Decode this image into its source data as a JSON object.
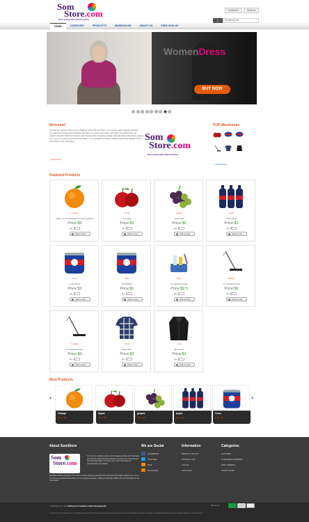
{
  "brand": {
    "line1": "Som",
    "line2a": "Store",
    "line2b": ".com",
    "tagline": "Best Quality Best Marchandise"
  },
  "toplinks": [
    "CONTACT",
    "SIGN IN"
  ],
  "cart": {
    "label": "Shopping Cart"
  },
  "nav": [
    "HOME",
    "CATEGORY",
    "PRODUCTS",
    "WAREHOUSE",
    "ABOUT US",
    "FREE SIGN UP"
  ],
  "banner": {
    "title_a": "Women",
    "title_b": "Dress",
    "button": "BUY NOW"
  },
  "welcome": {
    "title": "Welcome!",
    "text": "You can be confident when you're shopping online with SomStore. Our Secure online shopping website encrypts your personal and financial information to ensure your order information is protected.We use industry standard 128-bit encryption. Our Secure online shopping website locks all critical information passed from you to us, such as personal information, in an encrypted envelope, making it extremely difficult for this information to be intercepted.",
    "read_more": "» Read More"
  },
  "top_warehouse": {
    "title": "TOP Warehouse",
    "all_products": "» All Products"
  },
  "featured": {
    "title": "Featured Products",
    "price_label": "Price:",
    "qty_label": "Qty",
    "add_label": "Add to Cart",
    "items": [
      {
        "name": "Orange",
        "desc": "Rais_Un TV Harbours On land Heath E",
        "price": "$3",
        "qty": "1",
        "icon": "orange-icon"
      },
      {
        "name": "Apple",
        "desc": "for eating",
        "price": "$1",
        "qty": "1",
        "icon": "apple-icon"
      },
      {
        "name": "grapes",
        "desc": "fresh stuff",
        "price": "$2",
        "qty": "1",
        "icon": "grapes-icon"
      },
      {
        "name": "pepsi",
        "desc": "soda drinks",
        "price": "$1",
        "qty": "1",
        "icon": "pepsi-bottles-icon"
      },
      {
        "name": "Coca",
        "desc": "soda drinks",
        "price": "$1",
        "qty": "1",
        "icon": "pepsi-can-icon"
      },
      {
        "name": "Bad",
        "desc": "IS DRINKS",
        "price": "$1",
        "qty": "1",
        "icon": "pepsi-can-icon"
      },
      {
        "name": "Sisty",
        "desc": "for cleaning house",
        "price": "$2.5",
        "qty": "1",
        "icon": "cleaning-kit-icon"
      },
      {
        "name": "badger",
        "desc": "for cleaning house",
        "price": "$2",
        "qty": "1",
        "icon": "mop-icon"
      },
      {
        "name": "badgae",
        "desc": "for cleaning house",
        "price": "$3",
        "qty": "1",
        "icon": "mop-icon"
      },
      {
        "name": "Tshirt",
        "desc": "Best tshirt",
        "price": "$3",
        "qty": "1",
        "icon": "shirt-icon"
      },
      {
        "name": "Coat",
        "desc": "Best dress",
        "price": "$1",
        "qty": "1",
        "icon": "coat-icon"
      }
    ]
  },
  "best": {
    "title": "Best Products",
    "items": [
      {
        "name": "Orange",
        "price": "Price: $3",
        "icon": "orange-icon"
      },
      {
        "name": "Apple",
        "price": "Price: $1",
        "icon": "apple-icon"
      },
      {
        "name": "grapes",
        "price": "Price: $2",
        "icon": "grapes-icon"
      },
      {
        "name": "pepsi",
        "price": "Price: $1",
        "icon": "pepsi-bottles-icon"
      },
      {
        "name": "Coca",
        "price": "Price: $1",
        "icon": "pepsi-can-icon"
      }
    ]
  },
  "footer": {
    "about_title": "About SomStore",
    "about_text1": "You can be confident when you're shopping online with SomStore. Our Secure online shopping website encrypts your personal and financial information to ensure your order information is protected.We use industry",
    "about_text2": "standard 128-bit encryption. Our Secure online shopping website locks all critical information passed from you to us, such as personal information, in an encrypted envelope, making it extremely difficult for this information to be intercepted.",
    "social_title": "We are Social",
    "social": [
      "FACEBOOK",
      "TWITTER",
      "RSS",
      "BLOGGER"
    ],
    "info_title": "Information",
    "info": [
      "PRIVACY POLICY",
      "CONTACT US",
      "LOG IN",
      "ACCOUNT"
    ],
    "cat_title": "Categories",
    "categories": [
      "CLOTHES",
      "CLEANING MATERIAL",
      "SOFT DRINKS",
      "FOOD STUFF"
    ],
    "copyright_pre": "© SomStore.com 2013",
    "copyright_bold": "Welcome To SomStore Online Shopping Site",
    "legal": "© Copyright 2013 SomStore.com. All rights reserved. The information contained in SomStore.com may not be published, broadcast, rewritten, or redistributed without the prior written authority of SomStore.com",
    "we_accept": "We accept"
  }
}
